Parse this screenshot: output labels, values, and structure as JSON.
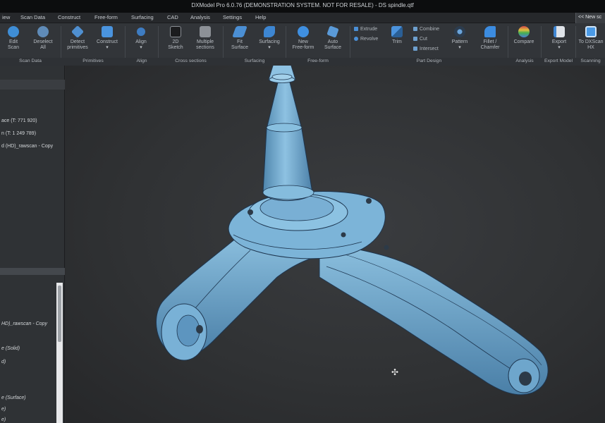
{
  "window": {
    "title": "DXModel Pro 6.0.76 (DEMONSTRATION SYSTEM. NOT FOR RESALE) - DS spindle.qtf"
  },
  "menu": {
    "items": [
      "iew",
      "Scan Data",
      "Construct",
      "Free-form",
      "Surfacing",
      "CAD",
      "Analysis",
      "Settings",
      "Help"
    ],
    "switch_label": "<< New sc"
  },
  "ribbon": {
    "buttons": {
      "edit_scan": "Edit\nScan",
      "deselect_all": "Deselect\nAll",
      "detect_primitives": "Detect\nprimitives",
      "construct": "Construct\n▾",
      "align": "Align\n▾",
      "sketch_2d": "2D\nSketch",
      "multiple_sections": "Multiple\nsections",
      "fit_surface": "Fit\nSurface",
      "surfacing": "Surfacing\n▾",
      "new_freeform": "New\nFree-form",
      "auto_surface": "Auto\nSurface",
      "trim": "Trim",
      "pattern": "Pattern\n▾",
      "fillet_chamfer": "Fillet /\nChamfer",
      "compare": "Compare",
      "export": "Export\n▾",
      "to_dxscan": "To DXScan\nHX"
    },
    "small_commands": {
      "extrude": "Extrude",
      "revolve": "Revolve",
      "combine": "Combine",
      "cut": "Cut",
      "intersect": "Intersect"
    },
    "groups": {
      "scan_data": "Scan Data",
      "primitives": "Primitives",
      "align": "Align",
      "cross_sections": "Cross sections",
      "surfacing": "Surfacing",
      "free_form": "Free-form",
      "part_design": "Part Design",
      "analysis": "Analysis",
      "export_model": "Export Model",
      "scanning": "Scanning"
    }
  },
  "left_panel": {
    "top_lines": [
      "ace (T: 771 920)",
      "n (T: 1 249 789)",
      "d (HD)_rawscan - Copy"
    ],
    "bottom_lines": [
      "HD)_rawscan - Copy",
      "e (Solid)",
      "d)",
      "e (Surface)",
      "e)",
      "e)"
    ]
  },
  "colors": {
    "model": "#6fa8cf",
    "model_shade": "#4d86b0",
    "model_light": "#93c4e2",
    "edge": "#1e3650",
    "viewport_bg": "#2d2f31"
  }
}
